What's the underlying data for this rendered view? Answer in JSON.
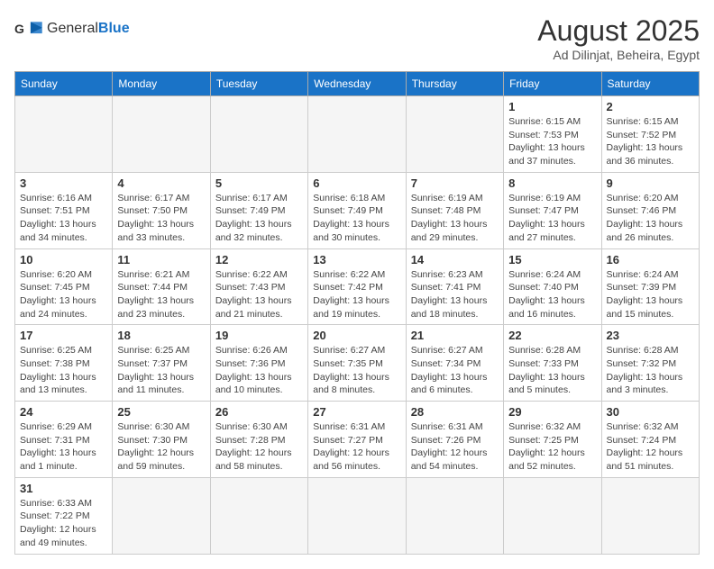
{
  "header": {
    "logo_general": "General",
    "logo_blue": "Blue",
    "month_year": "August 2025",
    "location": "Ad Dilinjat, Beheira, Egypt"
  },
  "weekdays": [
    "Sunday",
    "Monday",
    "Tuesday",
    "Wednesday",
    "Thursday",
    "Friday",
    "Saturday"
  ],
  "weeks": [
    [
      {
        "day": "",
        "info": ""
      },
      {
        "day": "",
        "info": ""
      },
      {
        "day": "",
        "info": ""
      },
      {
        "day": "",
        "info": ""
      },
      {
        "day": "",
        "info": ""
      },
      {
        "day": "1",
        "info": "Sunrise: 6:15 AM\nSunset: 7:53 PM\nDaylight: 13 hours and 37 minutes."
      },
      {
        "day": "2",
        "info": "Sunrise: 6:15 AM\nSunset: 7:52 PM\nDaylight: 13 hours and 36 minutes."
      }
    ],
    [
      {
        "day": "3",
        "info": "Sunrise: 6:16 AM\nSunset: 7:51 PM\nDaylight: 13 hours and 34 minutes."
      },
      {
        "day": "4",
        "info": "Sunrise: 6:17 AM\nSunset: 7:50 PM\nDaylight: 13 hours and 33 minutes."
      },
      {
        "day": "5",
        "info": "Sunrise: 6:17 AM\nSunset: 7:49 PM\nDaylight: 13 hours and 32 minutes."
      },
      {
        "day": "6",
        "info": "Sunrise: 6:18 AM\nSunset: 7:49 PM\nDaylight: 13 hours and 30 minutes."
      },
      {
        "day": "7",
        "info": "Sunrise: 6:19 AM\nSunset: 7:48 PM\nDaylight: 13 hours and 29 minutes."
      },
      {
        "day": "8",
        "info": "Sunrise: 6:19 AM\nSunset: 7:47 PM\nDaylight: 13 hours and 27 minutes."
      },
      {
        "day": "9",
        "info": "Sunrise: 6:20 AM\nSunset: 7:46 PM\nDaylight: 13 hours and 26 minutes."
      }
    ],
    [
      {
        "day": "10",
        "info": "Sunrise: 6:20 AM\nSunset: 7:45 PM\nDaylight: 13 hours and 24 minutes."
      },
      {
        "day": "11",
        "info": "Sunrise: 6:21 AM\nSunset: 7:44 PM\nDaylight: 13 hours and 23 minutes."
      },
      {
        "day": "12",
        "info": "Sunrise: 6:22 AM\nSunset: 7:43 PM\nDaylight: 13 hours and 21 minutes."
      },
      {
        "day": "13",
        "info": "Sunrise: 6:22 AM\nSunset: 7:42 PM\nDaylight: 13 hours and 19 minutes."
      },
      {
        "day": "14",
        "info": "Sunrise: 6:23 AM\nSunset: 7:41 PM\nDaylight: 13 hours and 18 minutes."
      },
      {
        "day": "15",
        "info": "Sunrise: 6:24 AM\nSunset: 7:40 PM\nDaylight: 13 hours and 16 minutes."
      },
      {
        "day": "16",
        "info": "Sunrise: 6:24 AM\nSunset: 7:39 PM\nDaylight: 13 hours and 15 minutes."
      }
    ],
    [
      {
        "day": "17",
        "info": "Sunrise: 6:25 AM\nSunset: 7:38 PM\nDaylight: 13 hours and 13 minutes."
      },
      {
        "day": "18",
        "info": "Sunrise: 6:25 AM\nSunset: 7:37 PM\nDaylight: 13 hours and 11 minutes."
      },
      {
        "day": "19",
        "info": "Sunrise: 6:26 AM\nSunset: 7:36 PM\nDaylight: 13 hours and 10 minutes."
      },
      {
        "day": "20",
        "info": "Sunrise: 6:27 AM\nSunset: 7:35 PM\nDaylight: 13 hours and 8 minutes."
      },
      {
        "day": "21",
        "info": "Sunrise: 6:27 AM\nSunset: 7:34 PM\nDaylight: 13 hours and 6 minutes."
      },
      {
        "day": "22",
        "info": "Sunrise: 6:28 AM\nSunset: 7:33 PM\nDaylight: 13 hours and 5 minutes."
      },
      {
        "day": "23",
        "info": "Sunrise: 6:28 AM\nSunset: 7:32 PM\nDaylight: 13 hours and 3 minutes."
      }
    ],
    [
      {
        "day": "24",
        "info": "Sunrise: 6:29 AM\nSunset: 7:31 PM\nDaylight: 13 hours and 1 minute."
      },
      {
        "day": "25",
        "info": "Sunrise: 6:30 AM\nSunset: 7:30 PM\nDaylight: 12 hours and 59 minutes."
      },
      {
        "day": "26",
        "info": "Sunrise: 6:30 AM\nSunset: 7:28 PM\nDaylight: 12 hours and 58 minutes."
      },
      {
        "day": "27",
        "info": "Sunrise: 6:31 AM\nSunset: 7:27 PM\nDaylight: 12 hours and 56 minutes."
      },
      {
        "day": "28",
        "info": "Sunrise: 6:31 AM\nSunset: 7:26 PM\nDaylight: 12 hours and 54 minutes."
      },
      {
        "day": "29",
        "info": "Sunrise: 6:32 AM\nSunset: 7:25 PM\nDaylight: 12 hours and 52 minutes."
      },
      {
        "day": "30",
        "info": "Sunrise: 6:32 AM\nSunset: 7:24 PM\nDaylight: 12 hours and 51 minutes."
      }
    ],
    [
      {
        "day": "31",
        "info": "Sunrise: 6:33 AM\nSunset: 7:22 PM\nDaylight: 12 hours and 49 minutes."
      },
      {
        "day": "",
        "info": ""
      },
      {
        "day": "",
        "info": ""
      },
      {
        "day": "",
        "info": ""
      },
      {
        "day": "",
        "info": ""
      },
      {
        "day": "",
        "info": ""
      },
      {
        "day": "",
        "info": ""
      }
    ]
  ]
}
